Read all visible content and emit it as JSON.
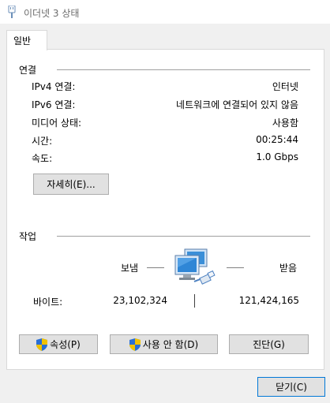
{
  "window": {
    "title": "이더넷 3 상태"
  },
  "tabs": [
    {
      "label": "일반"
    }
  ],
  "connection": {
    "section_label": "연결",
    "rows": [
      {
        "label": "IPv4 연결:",
        "value": "인터넷"
      },
      {
        "label": "IPv6 연결:",
        "value": "네트워크에 연결되어 있지 않음"
      },
      {
        "label": "미디어 상태:",
        "value": "사용함"
      },
      {
        "label": "시간:",
        "value": "00:25:44"
      },
      {
        "label": "속도:",
        "value": "1.0 Gbps"
      }
    ],
    "details_button": "자세히(E)..."
  },
  "activity": {
    "section_label": "작업",
    "sent_label": "보냄",
    "received_label": "받음",
    "bytes_label": "바이트:",
    "bytes_sent": "23,102,324",
    "bytes_received": "121,424,165"
  },
  "buttons": {
    "properties": "속성(P)",
    "disable": "사용 안 함(D)",
    "diagnose": "진단(G)",
    "close": "닫기(C)"
  },
  "colors": {
    "shield_blue": "#2a6fd6",
    "shield_yellow": "#f2c200",
    "monitor_blue": "#3b8fd8"
  }
}
